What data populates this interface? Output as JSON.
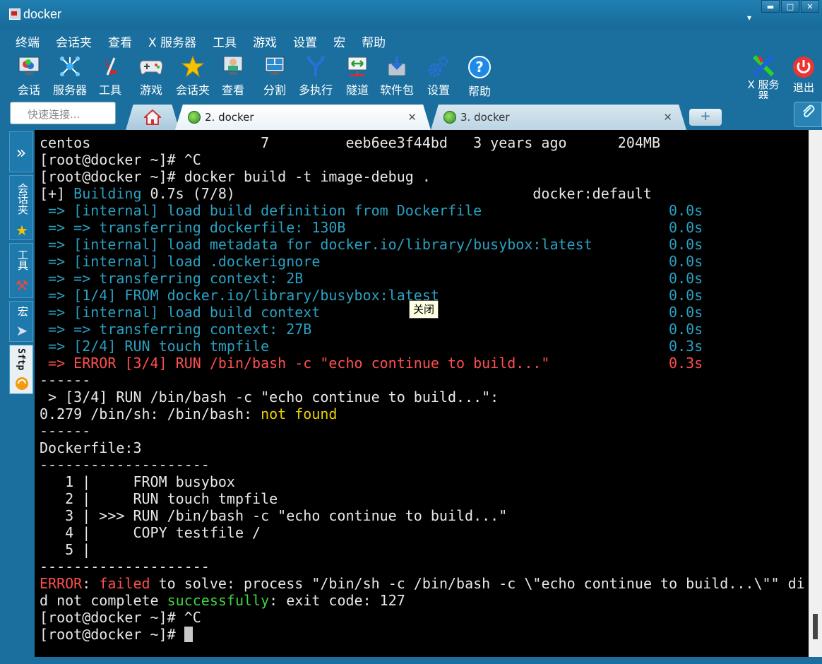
{
  "window": {
    "title": "docker",
    "minimize": "▬",
    "maximize": "□",
    "close": "✕",
    "options": "▾"
  },
  "menu": [
    "终端",
    "会话夹",
    "查看",
    "X 服务器",
    "工具",
    "游戏",
    "设置",
    "宏",
    "帮助"
  ],
  "toolbar": [
    {
      "label": "会话",
      "icon": "session-icon"
    },
    {
      "label": "服务器",
      "icon": "servers-icon"
    },
    {
      "label": "工具",
      "icon": "tools-icon"
    },
    {
      "label": "游戏",
      "icon": "games-icon"
    },
    {
      "label": "会话夹",
      "icon": "star-icon"
    },
    {
      "label": "查看",
      "icon": "view-icon"
    },
    {
      "label": "分割",
      "icon": "split-icon"
    },
    {
      "label": "多执行",
      "icon": "multiexec-icon"
    },
    {
      "label": "隧道",
      "icon": "tunnel-icon"
    },
    {
      "label": "软件包",
      "icon": "packages-icon"
    },
    {
      "label": "设置",
      "icon": "settings-icon"
    },
    {
      "label": "帮助",
      "icon": "help-icon"
    }
  ],
  "toolbar_right": [
    {
      "label": "X 服务器",
      "icon": "x-server-icon"
    },
    {
      "label": "退出",
      "icon": "power-icon"
    }
  ],
  "tabs": {
    "quick_connect_placeholder": "快速连接...",
    "items": [
      {
        "label": "2. docker",
        "active": true
      },
      {
        "label": "3. docker",
        "active": false
      }
    ],
    "close_glyph": "✕",
    "add_glyph": "+"
  },
  "side": {
    "expand": "»",
    "sessions": "会话夹",
    "tools": "工具",
    "macros": "宏",
    "sftp": "Sftp"
  },
  "tooltip": "关闭",
  "terminal": {
    "lines": [
      [
        {
          "t": "centos                    7         eeb6ee3f44bd   3 years ago      204MB"
        }
      ],
      [
        {
          "t": "[root@docker ~]# ^C"
        }
      ],
      [
        {
          "t": "[root@docker ~]# docker build -t image-debug ."
        }
      ],
      [
        {
          "t": "[+] "
        },
        {
          "t": "Building",
          "c": "blue"
        },
        {
          "t": " 0.7s (7/8)                                   docker:default"
        }
      ],
      [
        {
          "t": " => [internal] load build definition from Dockerfile                      0.0s",
          "c": "blue"
        }
      ],
      [
        {
          "t": " => => transferring dockerfile: 130B                                      0.0s",
          "c": "blue"
        }
      ],
      [
        {
          "t": " => [internal] load metadata for docker.io/library/busybox:latest         0.0s",
          "c": "blue"
        }
      ],
      [
        {
          "t": " => [internal] load .dockerignore                                         0.0s",
          "c": "blue"
        }
      ],
      [
        {
          "t": " => => transferring context: 2B                                           0.0s",
          "c": "blue"
        }
      ],
      [
        {
          "t": " => [1/4] FROM docker.io/library/busybox:latest                           0.0s",
          "c": "blue"
        }
      ],
      [
        {
          "t": " => [internal] load build context                                         0.0s",
          "c": "blue"
        }
      ],
      [
        {
          "t": " => => transferring context: 27B                                          0.0s",
          "c": "blue"
        }
      ],
      [
        {
          "t": " => [2/4] RUN touch tmpfile                                               0.3s",
          "c": "blue"
        }
      ],
      [
        {
          "t": " => ERROR [3/4] RUN /bin/bash -c \"echo continue to build...\"              0.3s",
          "c": "red"
        }
      ],
      [
        {
          "t": "------"
        }
      ],
      [
        {
          "t": " > [3/4] RUN /bin/bash -c \"echo continue to build...\":"
        }
      ],
      [
        {
          "t": "0.279 /bin/sh: /bin/bash: "
        },
        {
          "t": "not found",
          "c": "yellow"
        }
      ],
      [
        {
          "t": "------"
        }
      ],
      [
        {
          "t": "Dockerfile:3"
        }
      ],
      [
        {
          "t": "--------------------"
        }
      ],
      [
        {
          "t": "   1 |     FROM busybox"
        }
      ],
      [
        {
          "t": "   2 |     RUN touch tmpfile"
        }
      ],
      [
        {
          "t": "   3 | >>> RUN /bin/bash -c \"echo continue to build...\""
        }
      ],
      [
        {
          "t": "   4 |     COPY testfile /"
        }
      ],
      [
        {
          "t": "   5 |"
        }
      ],
      [
        {
          "t": "--------------------"
        }
      ],
      [
        {
          "t": "ERROR",
          "c": "red"
        },
        {
          "t": ": "
        },
        {
          "t": "failed",
          "c": "red"
        },
        {
          "t": " to solve: process \"/bin/sh -c /bin/bash -c \\\"echo continue to build...\\\"\" di"
        }
      ],
      [
        {
          "t": "d not complete "
        },
        {
          "t": "successfully",
          "c": "green"
        },
        {
          "t": ": exit code: 127"
        }
      ],
      [
        {
          "t": "[root@docker ~]# ^C"
        }
      ],
      [
        {
          "t": "[root@docker ~]# "
        },
        {
          "cursor": true
        }
      ]
    ]
  }
}
